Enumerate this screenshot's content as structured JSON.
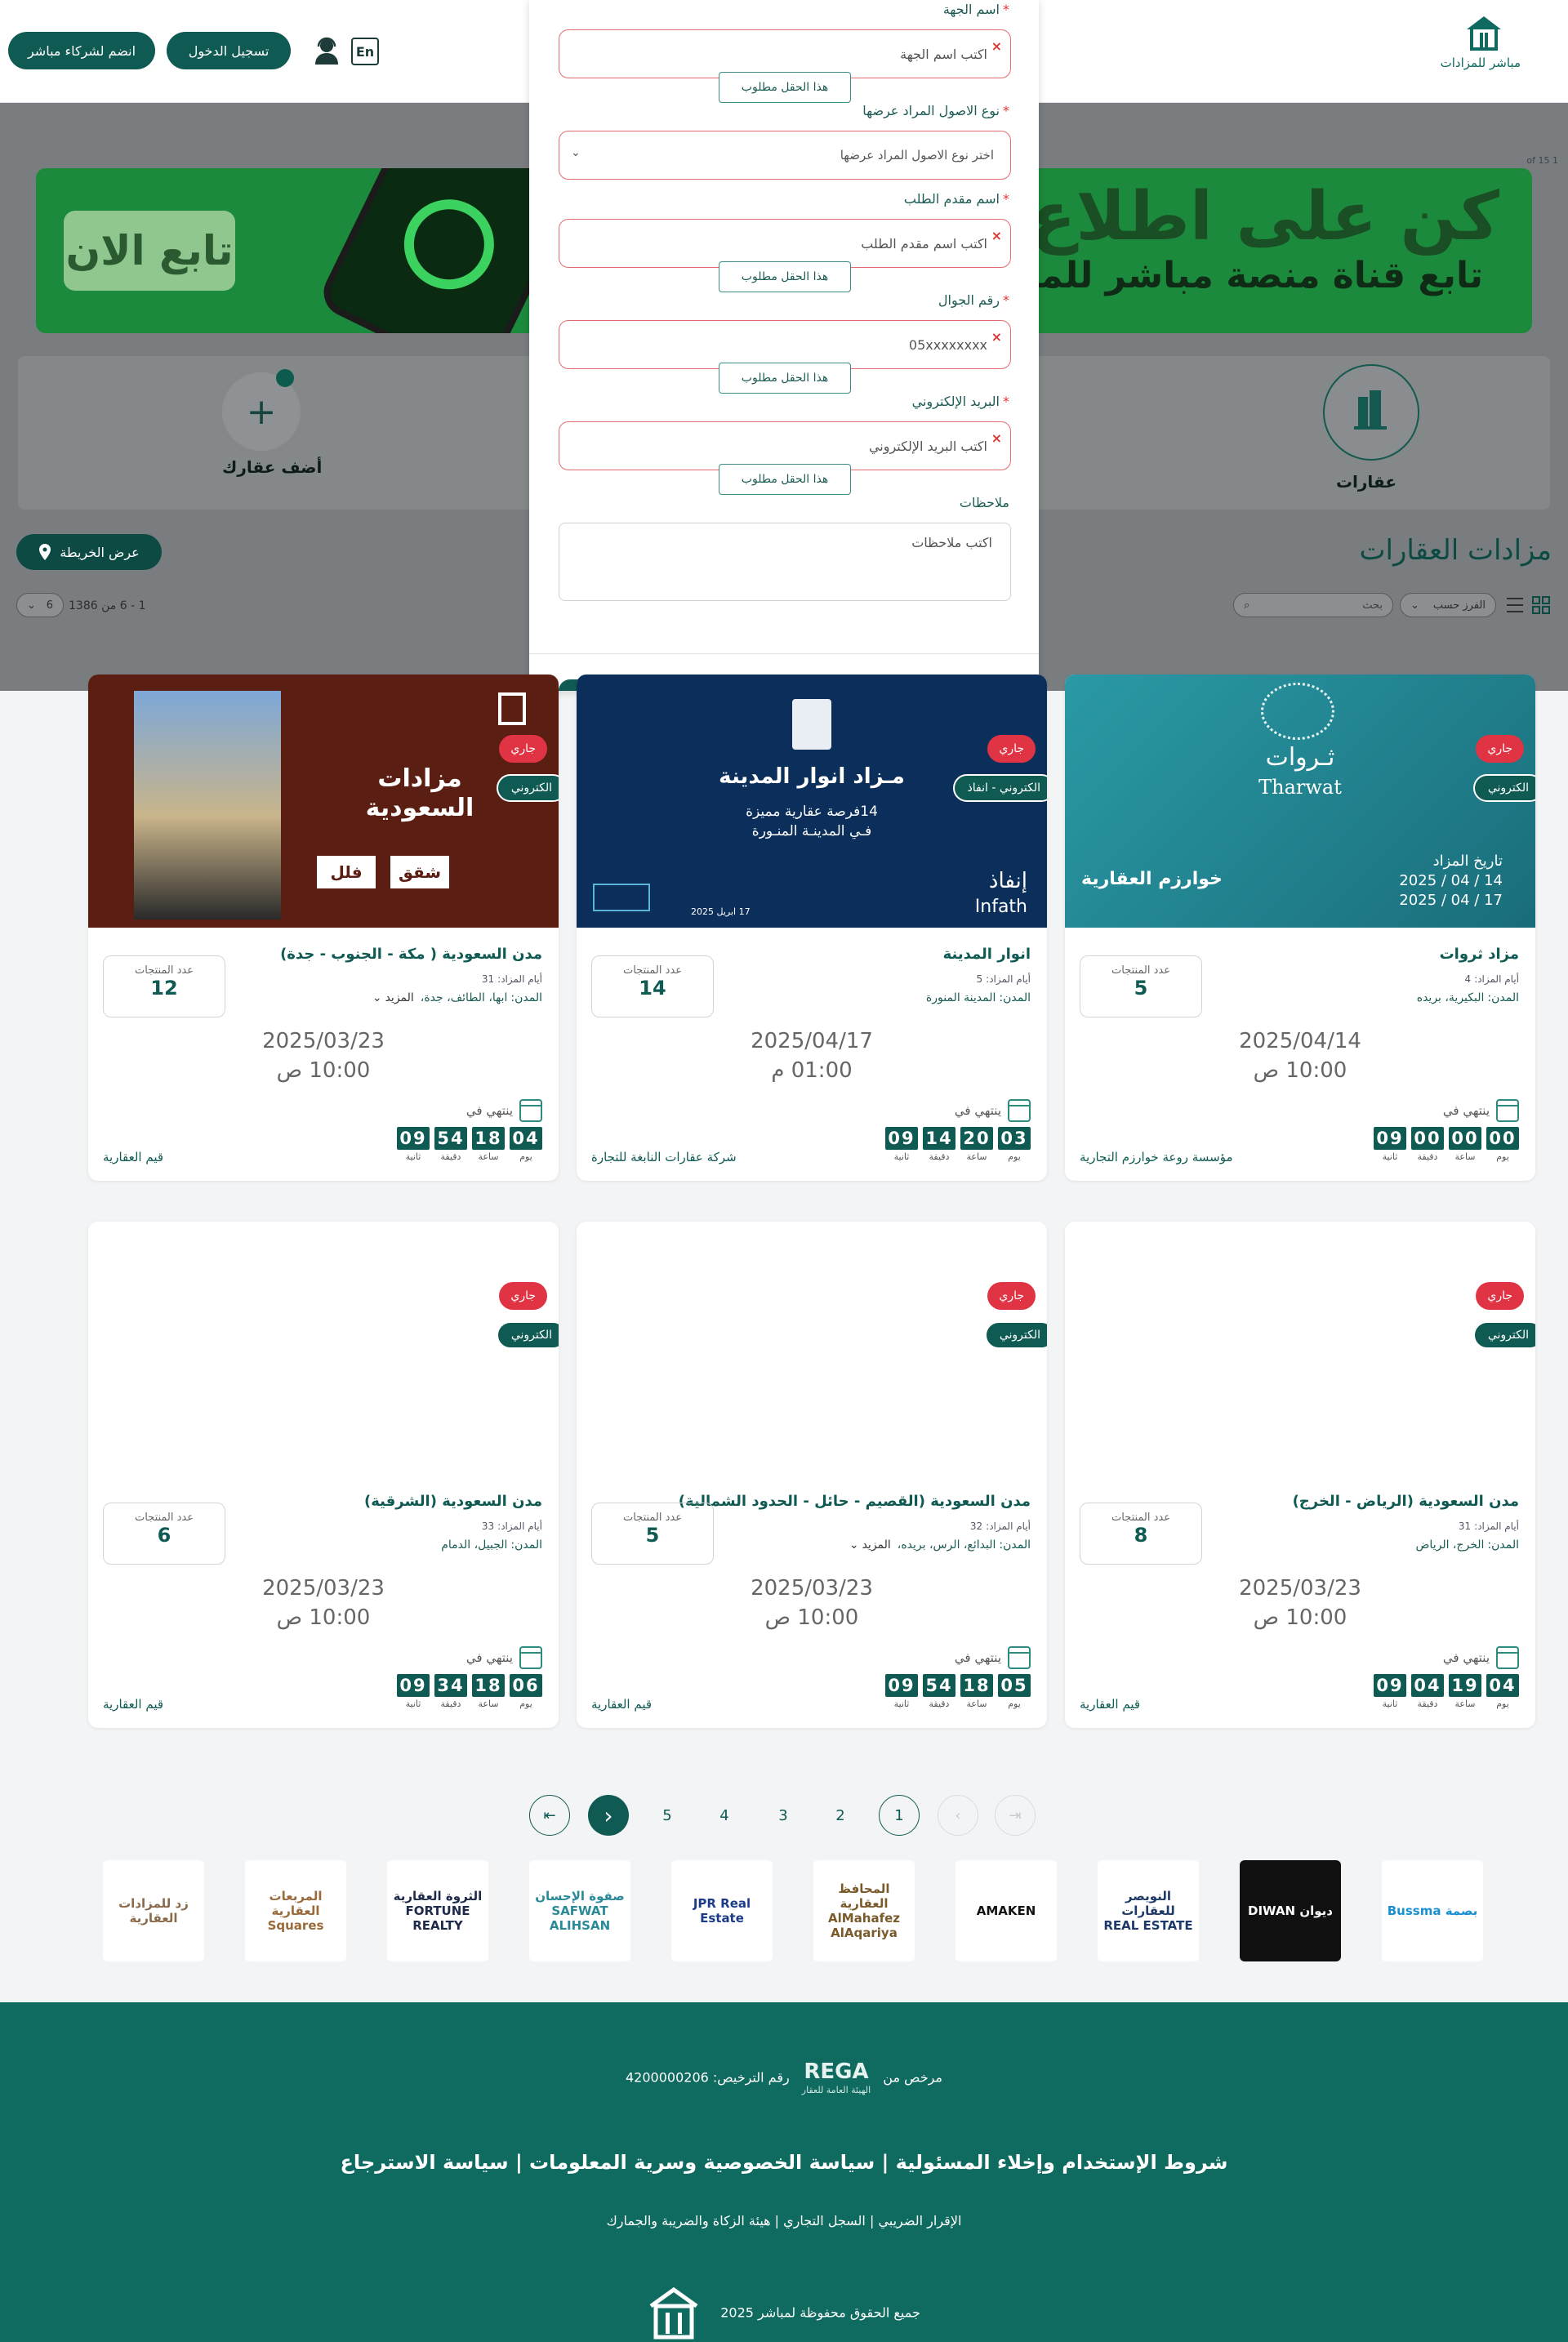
{
  "header": {
    "logo_text": "مباشر للمزادات",
    "lang_toggle": "En",
    "login_button": "تسجيل الدخول",
    "partners_button": "انضم لشركاء مباشر"
  },
  "banner": {
    "headline": "كن على اطلاع بكل",
    "subline": "تابع قناة منصة مباشر للمزادات",
    "follow_button": "تابع الان",
    "pager_text": "1 of 15"
  },
  "tiles": {
    "properties_label": "عقارات",
    "add_property_label": "أضف عقارك"
  },
  "section": {
    "title": "مزادات العقارات",
    "map_button": "عرض الخريطة",
    "sort_label": "الفرز حسب",
    "search_placeholder": "بحث",
    "results_text": "1 - 6 من 1386",
    "page_size": "6"
  },
  "modal": {
    "fields": [
      {
        "label": "اسم الجهة",
        "placeholder": "اكتب اسم الجهة",
        "error": "هذا الحقل مطلوب"
      },
      {
        "label": "نوع الاصول المراد عرضها",
        "placeholder": "اختر نوع الاصول المراد عرضها"
      },
      {
        "label": "اسم مقدم الطلب",
        "placeholder": "اكتب اسم مقدم الطلب",
        "error": "هذا الحقل مطلوب"
      },
      {
        "label": "رقم الجوال",
        "placeholder": "05xxxxxxxx",
        "error": "هذا الحقل مطلوب"
      },
      {
        "label": "البريد الإلكتروني",
        "placeholder": "اكتب البريد الإلكتروني",
        "error": "هذا الحقل مطلوب"
      },
      {
        "label": "ملاحظات",
        "placeholder": "اكتب ملاحظات"
      }
    ]
  },
  "card_labels": {
    "live": "جاري",
    "products": "عدد المنتجات",
    "ends_in": "ينتهي في",
    "auction_days": "أيام المزاد:",
    "cities": "المدن:",
    "more": "المزيد",
    "units": [
      "ثانية",
      "دقيقة",
      "ساعة",
      "يوم"
    ]
  },
  "cards": [
    {
      "title": "مزاد ثروات",
      "days": "4",
      "cities": "البكيرية، بريده",
      "more": false,
      "type": "الكتروني",
      "products": "5",
      "date": "2025/04/14",
      "time": "10:00 ص",
      "timer": [
        "09",
        "00",
        "00",
        "00"
      ],
      "org": "مؤسسة روعة خوارزم التجارية",
      "image": {
        "theme": "tharwat",
        "brand": "ثـروات",
        "brand_en": "Tharwat",
        "line1": "تاريخ المزاد",
        "line2": "2025 / 04 / 14",
        "line3": "2025 / 04 / 17",
        "partner": "خوارزم العقارية"
      }
    },
    {
      "title": "انوار المدينة",
      "days": "5",
      "cities": "المدينة المنورة",
      "more": false,
      "type": "الكتروني - انفاذ",
      "products": "14",
      "date": "2025/04/17",
      "time": "01:00 م",
      "timer": [
        "09",
        "14",
        "20",
        "03"
      ],
      "org": "شركة عقارات النابغة للتجارة",
      "image": {
        "theme": "anwar",
        "heading": "مـزاد انوار المدينة",
        "line1": "14فرصة عقارية مميزة",
        "line2": "فـي المدينـة المنـورة",
        "brand": "إنفاذ",
        "brand_en": "Infath",
        "date_small": "17 ابريل 2025"
      }
    },
    {
      "title": "مدن السعودية ( مكة - الجنوب - جدة)",
      "days": "31",
      "cities": "ابها، الطائف، جدة،",
      "more": true,
      "type": "الكتروني",
      "products": "12",
      "date": "2025/03/23",
      "time": "10:00 ص",
      "timer": [
        "09",
        "54",
        "18",
        "04"
      ],
      "org": "قيم العقارية",
      "image": {
        "theme": "saudi",
        "heading": "مزادات السعودية",
        "line1": "شقق",
        "line2": "فلل"
      }
    },
    {
      "title": "مدن السعودية (الرياض - الخرج)",
      "days": "31",
      "cities": "الخرج، الرياض",
      "more": false,
      "type": "الكتروني",
      "products": "8",
      "date": "2025/03/23",
      "time": "10:00 ص",
      "timer": [
        "09",
        "04",
        "19",
        "04"
      ],
      "org": "قيم العقارية",
      "image": {
        "theme": "blank"
      }
    },
    {
      "title": "مدن السعودية (القصيم - حائل - الحدود الشمالية)",
      "days": "32",
      "cities": "البدائع، الرس، بريده،",
      "more": true,
      "type": "الكتروني",
      "products": "5",
      "date": "2025/03/23",
      "time": "10:00 ص",
      "timer": [
        "09",
        "54",
        "18",
        "05"
      ],
      "org": "قيم العقارية",
      "image": {
        "theme": "blank"
      }
    },
    {
      "title": "مدن السعودية (الشرقية)",
      "days": "33",
      "cities": "الجبيل، الدمام",
      "more": false,
      "type": "الكتروني",
      "products": "6",
      "date": "2025/03/23",
      "time": "10:00 ص",
      "timer": [
        "09",
        "34",
        "18",
        "06"
      ],
      "org": "قيم العقارية",
      "image": {
        "theme": "blank"
      }
    }
  ],
  "pagination": {
    "pages": [
      "1",
      "2",
      "3",
      "4",
      "5"
    ],
    "current": "1"
  },
  "partners": [
    {
      "name": "بصمة Bussma",
      "color": "#1a8fd1"
    },
    {
      "name": "ديوان DIWAN",
      "color": "#ffffff"
    },
    {
      "name": "النويصر للعقارات REAL ESTATE",
      "color": "#1e3a6a"
    },
    {
      "name": "AMAKEN",
      "color": "#111111"
    },
    {
      "name": "المحافظ العقارية AlMahafez AlAqariya",
      "color": "#7a5a2a"
    },
    {
      "name": "JPR Real Estate",
      "color": "#1e3a8a"
    },
    {
      "name": "صفوة الإحسان SAFWAT ALIHSAN",
      "color": "#2a8a9a"
    },
    {
      "name": "الثروة العقارية FORTUNE REALTY",
      "color": "#1e2a4a"
    },
    {
      "name": "المربعات العقارية Squares",
      "color": "#9a6a3a"
    },
    {
      "name": "زد للمزادات العقارية",
      "color": "#8a6a4a"
    }
  ],
  "footer": {
    "licensed_by": "مرخص من",
    "rega": "REGA",
    "rega_sub": "الهيئة العامة للعقار",
    "license_label": "رقم الترخيص:",
    "license_number": "4200000206",
    "links": "شروط الإستخدام وإخلاء المسئولية | سياسة الخصوصية وسرية المعلومات | سياسة الاسترجاع",
    "sub_links": "الإقرار الضريبي | السجل التجاري | هيئة الزكاة والضريبة والجمارك",
    "copyright": "جميع الحقوق محفوظة لمباشر 2025"
  }
}
